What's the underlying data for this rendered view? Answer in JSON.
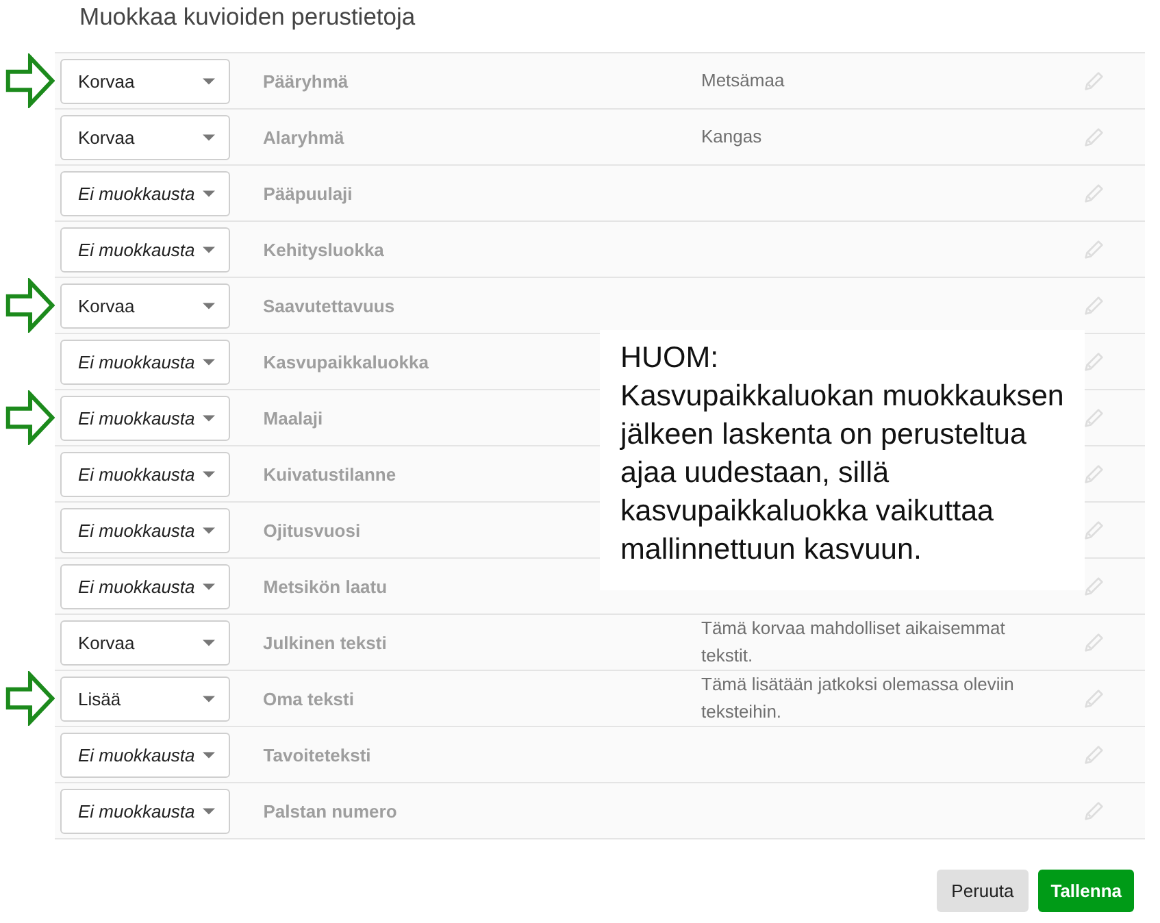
{
  "title": "Muokkaa kuvioiden perustietoja",
  "rows": [
    {
      "marked": true,
      "mode": {
        "kind": "change",
        "text": "Korvaa"
      },
      "label": "Pääryhmä",
      "value": "Metsämaa"
    },
    {
      "marked": false,
      "mode": {
        "kind": "change",
        "text": "Korvaa"
      },
      "label": "Alaryhmä",
      "value": "Kangas"
    },
    {
      "marked": false,
      "mode": {
        "kind": "unchanged",
        "text": "Ei muokkausta"
      },
      "label": "Pääpuulaji"
    },
    {
      "marked": false,
      "mode": {
        "kind": "unchanged",
        "text": "Ei muokkausta"
      },
      "label": "Kehitysluokka"
    },
    {
      "marked": true,
      "mode": {
        "kind": "change",
        "text": "Korvaa"
      },
      "label": "Saavutettavuus"
    },
    {
      "marked": false,
      "mode": {
        "kind": "unchanged",
        "text": "Ei muokkausta"
      },
      "label": "Kasvupaikkaluokka"
    },
    {
      "marked": true,
      "mode": {
        "kind": "unchanged",
        "text": "Ei muokkausta"
      },
      "label": "Maalaji"
    },
    {
      "marked": false,
      "mode": {
        "kind": "unchanged",
        "text": "Ei muokkausta"
      },
      "label": "Kuivatustilanne"
    },
    {
      "marked": false,
      "mode": {
        "kind": "unchanged",
        "text": "Ei muokkausta"
      },
      "label": "Ojitusvuosi"
    },
    {
      "marked": false,
      "mode": {
        "kind": "unchanged",
        "text": "Ei muokkausta"
      },
      "label": "Metsikön laatu"
    },
    {
      "marked": false,
      "mode": {
        "kind": "change",
        "text": "Korvaa"
      },
      "label": "Julkinen teksti",
      "value": "Tämä korvaa mahdolliset aikaisemmat tekstit."
    },
    {
      "marked": true,
      "mode": {
        "kind": "change",
        "text": "Lisää"
      },
      "label": "Oma teksti",
      "value": "Tämä lisätään jatkoksi olemassa oleviin teksteihin."
    },
    {
      "marked": false,
      "mode": {
        "kind": "unchanged",
        "text": "Ei muokkausta"
      },
      "label": "Tavoiteteksti"
    },
    {
      "marked": false,
      "mode": {
        "kind": "unchanged",
        "text": "Ei muokkausta"
      },
      "label": "Palstan numero"
    }
  ],
  "note": {
    "heading": "HUOM:",
    "text": "Kasvupaikkaluokan muokkauksen jälkeen laskenta on perusteltua ajaa uudestaan, sillä kasvupaikkaluokka vaikuttaa mallinnettuun kasvuun."
  },
  "buttons": [
    {
      "kind": "secondary",
      "label": "Peruuta"
    },
    {
      "kind": "primary",
      "label": "Tallenna"
    }
  ]
}
